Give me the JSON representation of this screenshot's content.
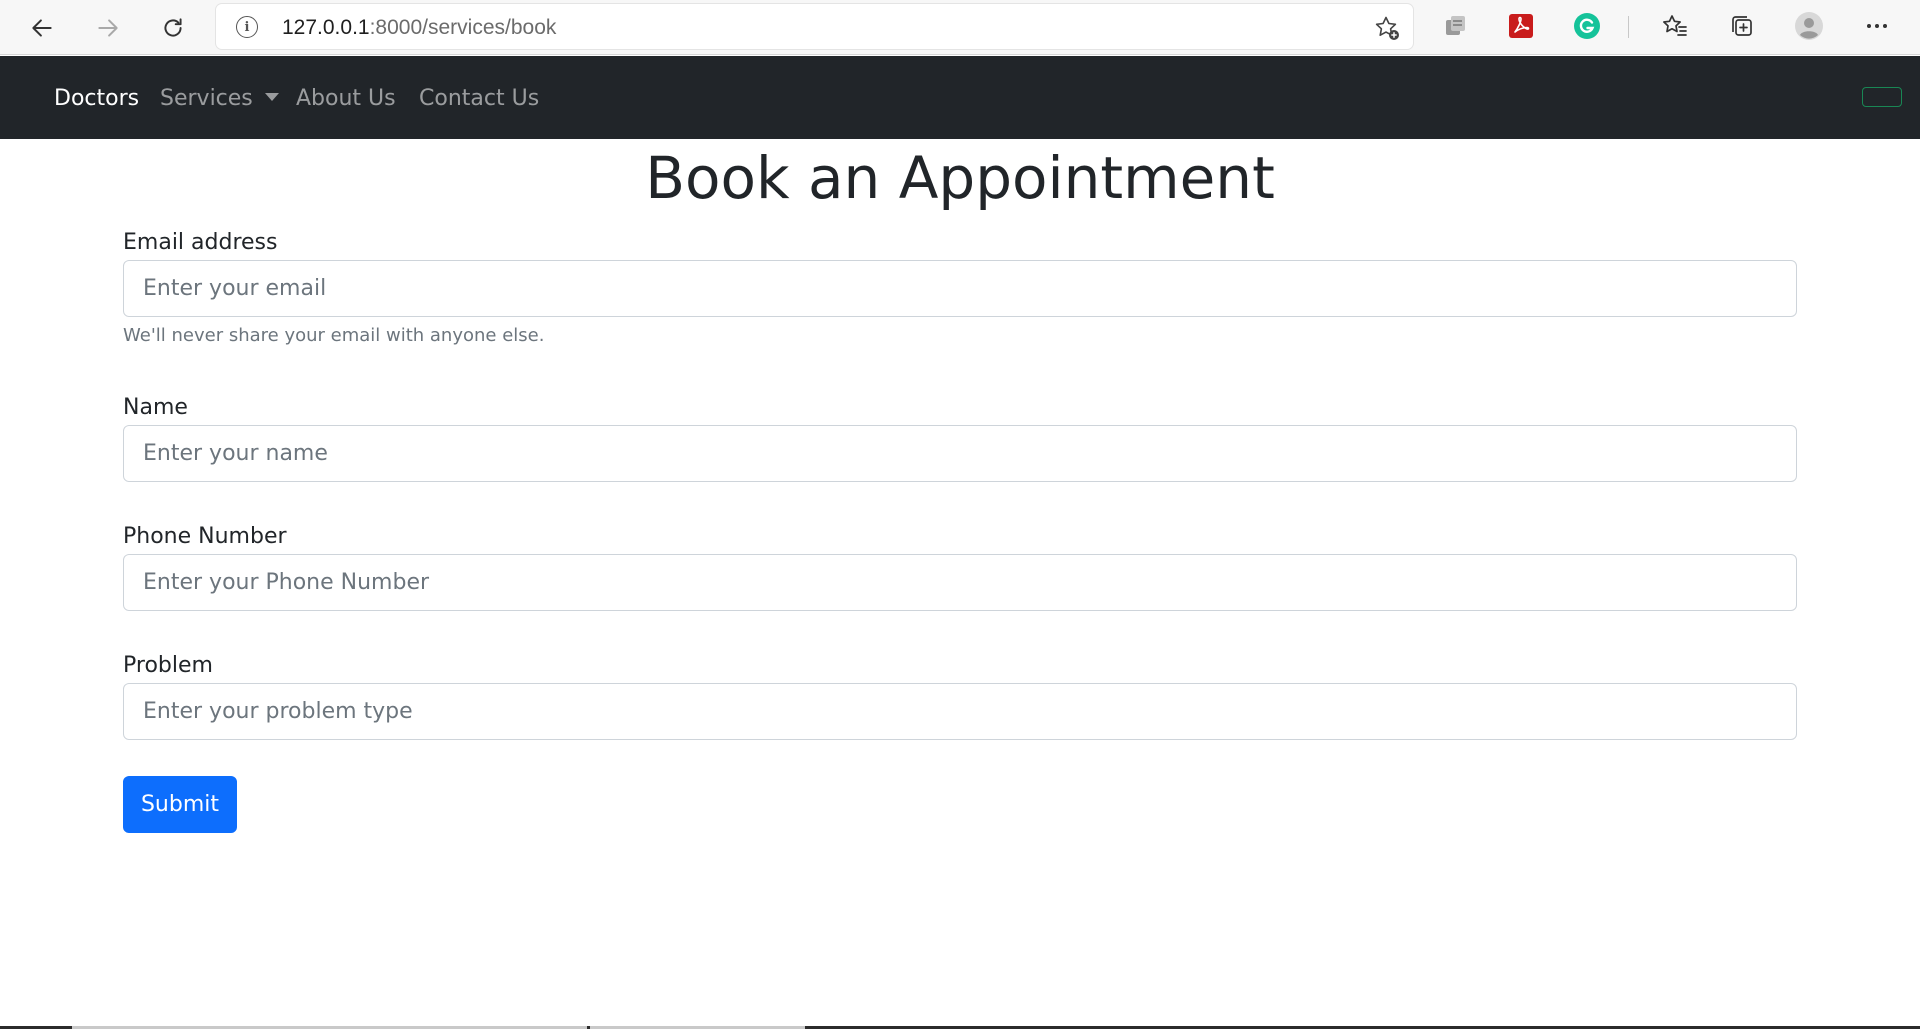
{
  "browser": {
    "url_host": "127.0.0.1",
    "url_path": ":8000/services/book",
    "icons": {
      "back": "arrow-left-icon",
      "forward": "arrow-right-icon",
      "reload": "reload-icon",
      "site_info": "info-icon",
      "add_favorite": "star-plus-icon",
      "extension_1": "extension-icon",
      "extension_pdf": "adobe-pdf-icon",
      "extension_grammarly": "grammarly-icon",
      "favorites": "favorites-list-icon",
      "collections": "collections-icon",
      "profile": "profile-avatar-icon",
      "menu": "more-options-icon"
    },
    "info_glyph": "i"
  },
  "navbar": {
    "brand": "Doctors",
    "links": [
      "Services",
      "About Us",
      "Contact Us"
    ],
    "background": "#212529",
    "toggle_color": "#198754"
  },
  "page": {
    "title": "Book an Appointment"
  },
  "form": {
    "email": {
      "label": "Email address",
      "placeholder": "Enter your email",
      "value": "",
      "help": "We'll never share your email with anyone else."
    },
    "name": {
      "label": "Name",
      "placeholder": "Enter your name",
      "value": ""
    },
    "phone": {
      "label": "Phone Number",
      "placeholder": "Enter your Phone Number",
      "value": ""
    },
    "problem": {
      "label": "Problem",
      "placeholder": "Enter your problem type",
      "value": ""
    },
    "submit_label": "Submit",
    "primary_color": "#0d6efd"
  }
}
